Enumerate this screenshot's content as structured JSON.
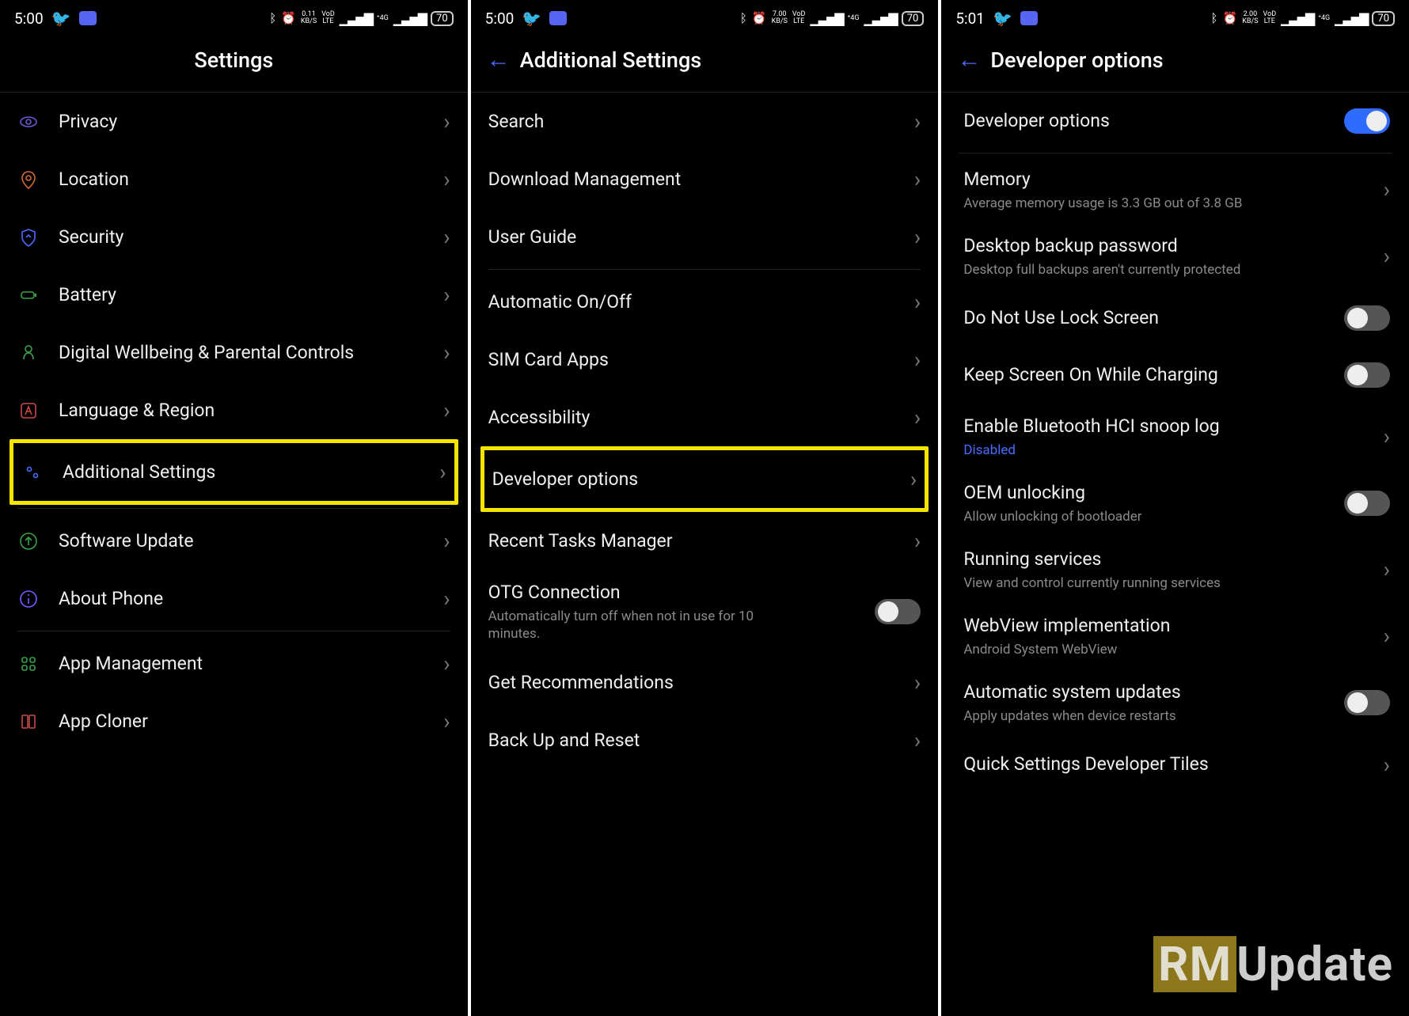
{
  "panels": [
    {
      "status": {
        "time": "5:00",
        "speed_val": "0.11",
        "speed_unit": "KB/S",
        "volte": "VoD",
        "lte": "LTE",
        "net": "4G",
        "battery": "70"
      },
      "title": "Settings",
      "has_back": false,
      "rows": [
        {
          "kind": "item",
          "icon": "eye",
          "label": "Privacy",
          "chev": true
        },
        {
          "kind": "item",
          "icon": "pin",
          "label": "Location",
          "chev": true
        },
        {
          "kind": "item",
          "icon": "shield",
          "label": "Security",
          "chev": true
        },
        {
          "kind": "item",
          "icon": "batt",
          "label": "Battery",
          "chev": true
        },
        {
          "kind": "item",
          "icon": "heart",
          "label": "Digital Wellbeing & Parental Controls",
          "chev": true
        },
        {
          "kind": "item",
          "icon": "langA",
          "label": "Language & Region",
          "chev": true
        },
        {
          "kind": "item",
          "icon": "dots",
          "label": "Additional Settings",
          "chev": true,
          "highlight": true
        },
        {
          "kind": "divider"
        },
        {
          "kind": "item",
          "icon": "up",
          "label": "Software Update",
          "chev": true
        },
        {
          "kind": "item",
          "icon": "info",
          "label": "About Phone",
          "chev": true
        },
        {
          "kind": "divider"
        },
        {
          "kind": "item",
          "icon": "grid",
          "label": "App Management",
          "chev": true
        },
        {
          "kind": "item",
          "icon": "clone",
          "label": "App Cloner",
          "chev": true
        }
      ]
    },
    {
      "status": {
        "time": "5:00",
        "speed_val": "7.00",
        "speed_unit": "KB/S",
        "volte": "VoD",
        "lte": "LTE",
        "net": "4G",
        "battery": "70"
      },
      "title": "Additional Settings",
      "has_back": true,
      "rows": [
        {
          "kind": "item",
          "label": "Search",
          "chev": true
        },
        {
          "kind": "item",
          "label": "Download Management",
          "chev": true
        },
        {
          "kind": "item",
          "label": "User Guide",
          "chev": true
        },
        {
          "kind": "divider"
        },
        {
          "kind": "item",
          "label": "Automatic On/Off",
          "chev": true
        },
        {
          "kind": "item",
          "label": "SIM Card Apps",
          "chev": true
        },
        {
          "kind": "item",
          "label": "Accessibility",
          "chev": true
        },
        {
          "kind": "item",
          "label": "Developer options",
          "chev": true,
          "highlight": true
        },
        {
          "kind": "item",
          "label": "Recent Tasks Manager",
          "chev": true
        },
        {
          "kind": "item",
          "label": "OTG Connection",
          "sub": "Automatically turn off when not in use for 10 minutes.",
          "toggle": "off"
        },
        {
          "kind": "item",
          "label": "Get Recommendations",
          "chev": true
        },
        {
          "kind": "item",
          "label": "Back Up and Reset",
          "chev": true
        }
      ]
    },
    {
      "status": {
        "time": "5:01",
        "speed_val": "2.00",
        "speed_unit": "KB/S",
        "volte": "VoD",
        "lte": "LTE",
        "net": "4G",
        "battery": "70"
      },
      "title": "Developer options",
      "has_back": true,
      "rows": [
        {
          "kind": "item",
          "label": "Developer options",
          "toggle": "on"
        },
        {
          "kind": "divider"
        },
        {
          "kind": "item",
          "label": "Memory",
          "sub": "Average memory usage is 3.3 GB out of 3.8 GB",
          "chev": true
        },
        {
          "kind": "item",
          "label": "Desktop backup password",
          "sub": "Desktop full backups aren't currently protected",
          "chev": true
        },
        {
          "kind": "item",
          "label": "Do Not Use Lock Screen",
          "toggle": "off"
        },
        {
          "kind": "item",
          "label": "Keep Screen On While Charging",
          "toggle": "off"
        },
        {
          "kind": "item",
          "label": "Enable Bluetooth HCI snoop log",
          "sub": "Disabled",
          "sub_blue": true,
          "chev": true
        },
        {
          "kind": "item",
          "label": "OEM unlocking",
          "sub": "Allow unlocking of bootloader",
          "toggle": "off"
        },
        {
          "kind": "item",
          "label": "Running services",
          "sub": "View and control currently running services",
          "chev": true
        },
        {
          "kind": "item",
          "label": "WebView implementation",
          "sub": "Android System WebView",
          "chev": true
        },
        {
          "kind": "item",
          "label": "Automatic system updates",
          "sub": "Apply updates when device restarts",
          "toggle": "off"
        },
        {
          "kind": "item",
          "label": "Quick Settings Developer Tiles",
          "chev": true
        }
      ]
    }
  ],
  "watermark": {
    "hl": "RM",
    "rest": "Update"
  }
}
